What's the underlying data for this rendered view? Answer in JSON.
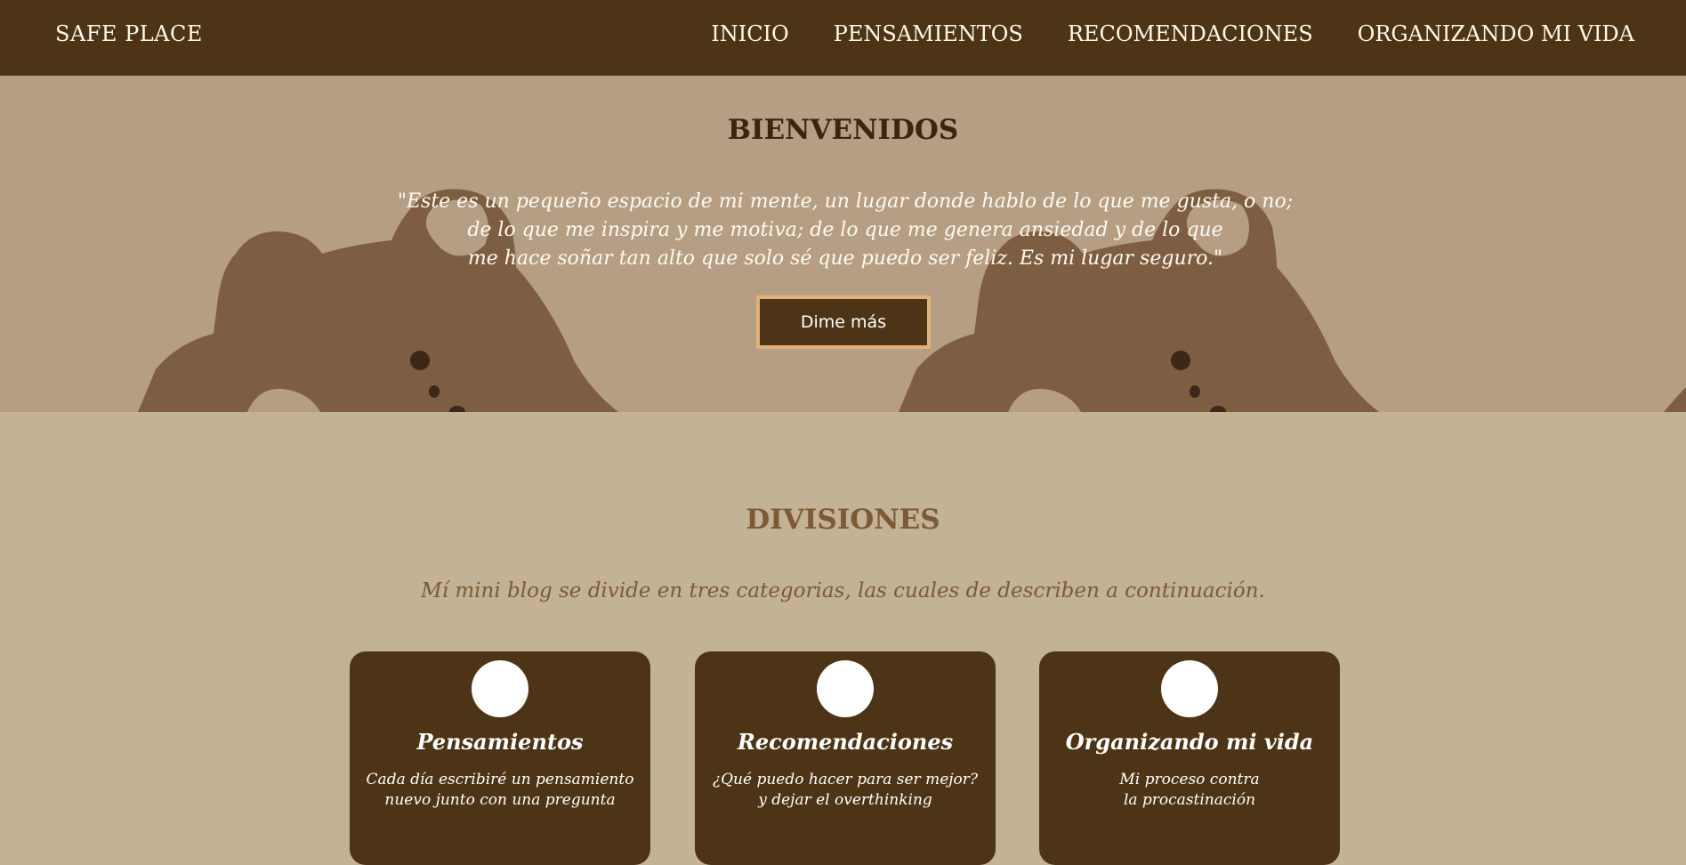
{
  "nav": {
    "brand": "SAFE PLACE",
    "links": [
      "INICIO",
      "PENSAMIENTOS",
      "RECOMENDACIONES",
      "ORGANIZANDO MI VIDA"
    ]
  },
  "hero": {
    "title": "BIENVENIDOS",
    "quote_lines": [
      "\"Este es un pequeño espacio de mi mente, un lugar donde hablo de lo que me gusta, o no;",
      "de lo que me inspira y me motiva; de lo que me genera ansiedad y de lo que",
      "me hace soñar tan alto que solo sé que puedo ser feliz. Es mi lugar seguro.\""
    ],
    "button_label": "Dime más"
  },
  "divisiones": {
    "title": "DIVISIONES",
    "subtitle": "Mí mini blog se divide en tres categorias, las cuales de describen a continuación.",
    "cards": [
      {
        "title": "Pensamientos",
        "lines": [
          "Cada día escribiré un pensamiento",
          "nuevo junto con una pregunta",
          ""
        ]
      },
      {
        "title": "Recomendaciones",
        "lines": [
          "¿Qué puedo hacer para ser mejor?",
          "y dejar el overthinking",
          ""
        ]
      },
      {
        "title": "Organizando mi vida",
        "lines": [
          "Mi proceso contra",
          "la procastinación",
          ""
        ]
      }
    ]
  },
  "colors": {
    "nav_bg": "#4d3417",
    "hero_bg": "#b59e84",
    "bear": "#7e5e43",
    "page_bg": "#c3b295",
    "accent": "#e0b17b",
    "section_text": "#7c5a37"
  }
}
